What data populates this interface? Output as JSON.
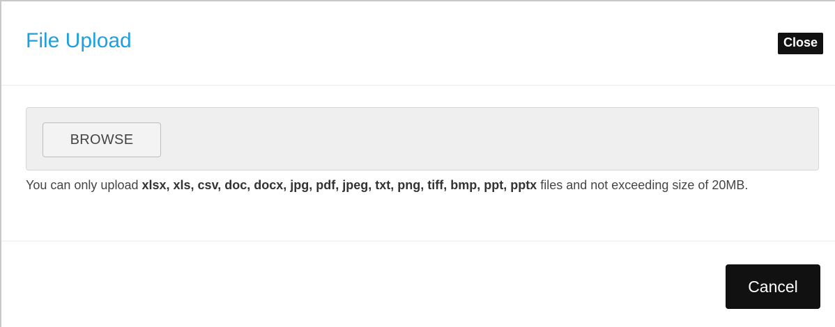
{
  "dialog": {
    "title": "File Upload",
    "close_label": "Close"
  },
  "upload": {
    "browse_label": "BROWSE",
    "help_prefix": "You can only upload ",
    "allowed_types": "xlsx, xls, csv, doc, docx, jpg, pdf, jpeg, txt, png, tiff, bmp, ppt, pptx",
    "help_suffix": " files and not exceeding size of 20MB."
  },
  "footer": {
    "cancel_label": "Cancel"
  },
  "colors": {
    "title": "#1e9fe0",
    "button_dark": "#111111",
    "file_box_bg": "#efefef"
  }
}
